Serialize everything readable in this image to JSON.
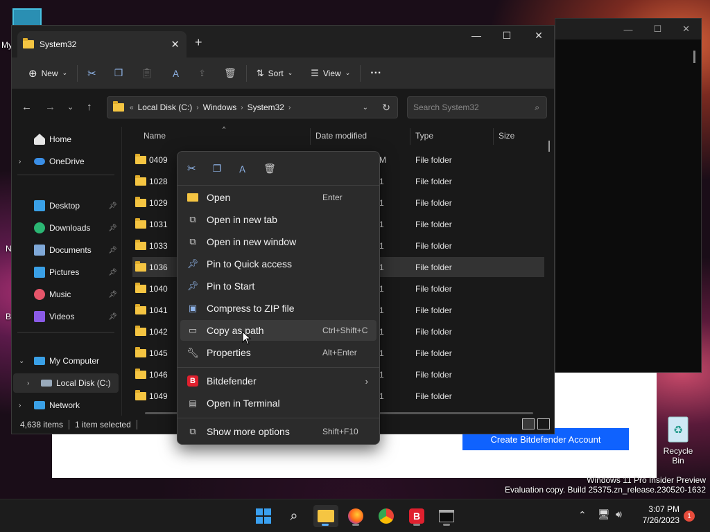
{
  "desktop": {
    "left_labels": [
      "My",
      "N",
      "B"
    ],
    "recycle_bin_label": "Recycle Bin",
    "watermark_line1": "Windows 11 Pro Insider Preview",
    "watermark_line2": "Evaluation copy. Build 25375.zn_release.230520-1632"
  },
  "bitdefender": {
    "button_label": "Create Bitdefender Account"
  },
  "explorer": {
    "tab_title": "System32",
    "toolbar": {
      "new_label": "New",
      "sort_label": "Sort",
      "view_label": "View"
    },
    "breadcrumb": [
      "Local Disk (C:)",
      "Windows",
      "System32"
    ],
    "breadcrumb_overflow": "«",
    "search_placeholder": "Search System32",
    "sidebar": {
      "home": "Home",
      "onedrive": "OneDrive",
      "desktop": "Desktop",
      "downloads": "Downloads",
      "documents": "Documents",
      "pictures": "Pictures",
      "music": "Music",
      "videos": "Videos",
      "my_computer": "My Computer",
      "local_disk": "Local Disk (C:)",
      "network": "Network"
    },
    "columns": {
      "name": "Name",
      "date_modified": "Date modified",
      "type": "Type",
      "size": "Size"
    },
    "rows": [
      {
        "name": "0409",
        "type": "File folder",
        "date_frag": "M"
      },
      {
        "name": "1028",
        "type": "File folder",
        "date_frag": "1"
      },
      {
        "name": "1029",
        "type": "File folder",
        "date_frag": "1"
      },
      {
        "name": "1031",
        "type": "File folder",
        "date_frag": "1"
      },
      {
        "name": "1033",
        "type": "File folder",
        "date_frag": "1"
      },
      {
        "name": "1036",
        "type": "File folder",
        "date_frag": "1"
      },
      {
        "name": "1040",
        "type": "File folder",
        "date_frag": "1"
      },
      {
        "name": "1041",
        "type": "File folder",
        "date_frag": "1"
      },
      {
        "name": "1042",
        "type": "File folder",
        "date_frag": "1"
      },
      {
        "name": "1045",
        "type": "File folder",
        "date_frag": "1"
      },
      {
        "name": "1046",
        "type": "File folder",
        "date_frag": "1"
      },
      {
        "name": "1049",
        "type": "File folder",
        "date_frag": "1"
      }
    ],
    "status": {
      "items": "4,638 items",
      "selected": "1 item selected"
    }
  },
  "context_menu": {
    "items": [
      {
        "label": "Open",
        "shortcut": "Enter"
      },
      {
        "label": "Open in new tab",
        "shortcut": ""
      },
      {
        "label": "Open in new window",
        "shortcut": ""
      },
      {
        "label": "Pin to Quick access",
        "shortcut": ""
      },
      {
        "label": "Pin to Start",
        "shortcut": ""
      },
      {
        "label": "Compress to ZIP file",
        "shortcut": ""
      },
      {
        "label": "Copy as path",
        "shortcut": "Ctrl+Shift+C"
      },
      {
        "label": "Properties",
        "shortcut": "Alt+Enter"
      },
      {
        "label": "Bitdefender",
        "shortcut": ""
      },
      {
        "label": "Open in Terminal",
        "shortcut": ""
      },
      {
        "label": "Show more options",
        "shortcut": "Shift+F10"
      }
    ]
  },
  "taskbar": {
    "time": "3:07 PM",
    "date": "7/26/2023",
    "notification_count": "1"
  },
  "colors": {
    "folder": "#f5c542",
    "accent": "#0f62fe",
    "bitdefender_red": "#e0202e"
  }
}
